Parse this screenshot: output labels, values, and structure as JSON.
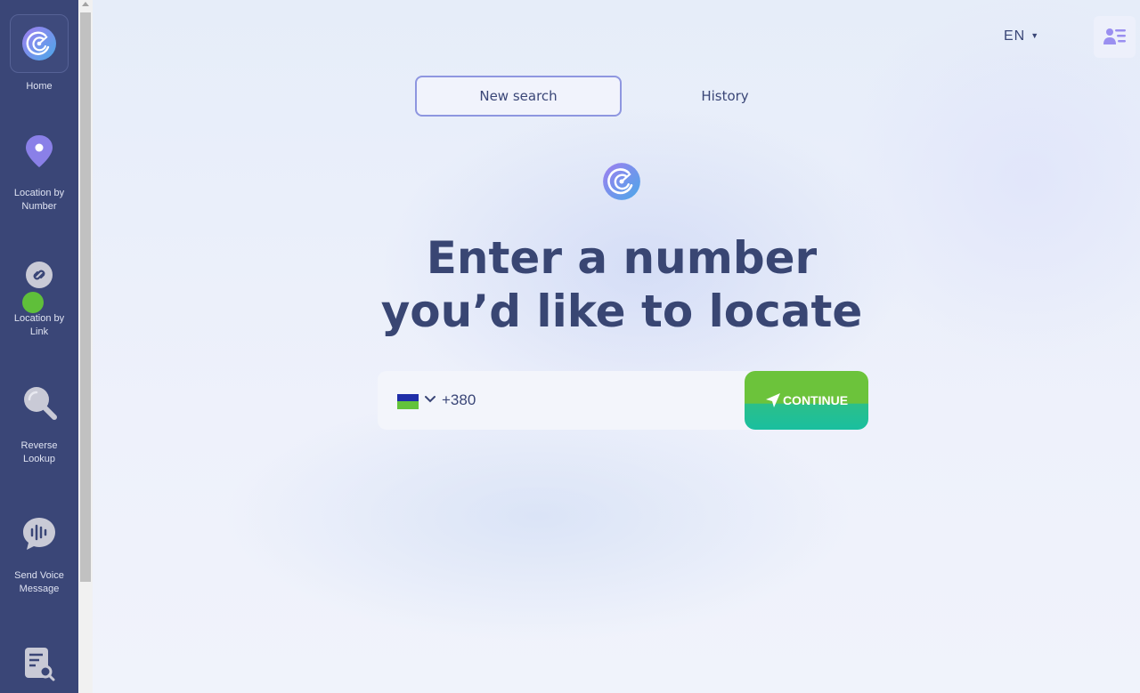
{
  "sidebar": {
    "items": [
      {
        "label": "Home",
        "icon": "radar-logo-icon"
      },
      {
        "label": "Location by\nNumber",
        "icon": "map-pin-icon"
      },
      {
        "label": "Location by\nLink",
        "icon": "link-icon"
      },
      {
        "label": "Reverse\nLookup",
        "icon": "magnifier-icon"
      },
      {
        "label": "Send Voice\nMessage",
        "icon": "voice-message-icon"
      },
      {
        "label": "",
        "icon": "document-search-icon"
      }
    ]
  },
  "header": {
    "language": "EN",
    "profile_icon": "profile-list-icon"
  },
  "tabs": [
    {
      "label": "New search",
      "active": true
    },
    {
      "label": "History",
      "active": false
    }
  ],
  "main": {
    "headline_line1": "Enter a number",
    "headline_line2": "you’d like to locate",
    "search": {
      "value": "+380",
      "country_flag": "Ukraine",
      "button_label": "CONTINUE"
    }
  },
  "colors": {
    "sidebar_bg": "#3a4677",
    "text_primary": "#394673",
    "accent_purple": "#8e96e0",
    "button_green": "#6cc33b",
    "button_teal": "#1abf9f"
  }
}
